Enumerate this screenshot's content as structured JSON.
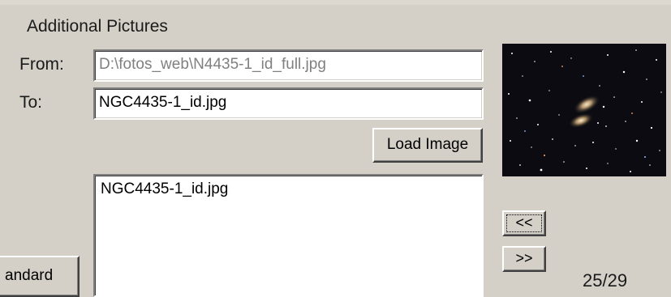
{
  "group": {
    "title": "Additional Pictures"
  },
  "from": {
    "label": "From:",
    "value": "D:\\fotos_web\\N4435-1_id_full.jpg"
  },
  "to": {
    "label": "To:",
    "value": "NGC4435-1_id.jpg"
  },
  "buttons": {
    "load_image": "Load Image",
    "prev": "<<",
    "next": ">>",
    "standard_partial": "andard"
  },
  "picture_list": {
    "items": [
      "NGC4435-1_id.jpg"
    ]
  },
  "pager": {
    "counter": "25/29"
  },
  "preview": {
    "subject": "galaxy-star-field"
  }
}
